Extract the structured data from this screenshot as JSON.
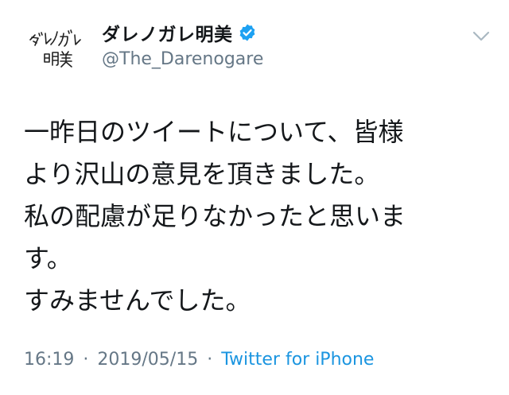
{
  "tweet": {
    "display_name": "ダレノガレ明美",
    "handle": "@The_Darenogare",
    "avatar_alt": "ダレノガレ明美",
    "text_lines": [
      "一昨日のツイートについて、皆様",
      "より沢山の意見を頂きました。",
      "私の配慮が足りなかったと思いま",
      "す。",
      "すみませんでした。"
    ],
    "time": "16:19",
    "date": "2019/05/15",
    "separator": "·",
    "source": "Twitter for iPhone"
  },
  "colors": {
    "text": "#14171a",
    "secondary": "#657786",
    "link": "#1b95e0",
    "verified": "#1da1f2"
  },
  "icons": {
    "verified": "verified-badge-icon",
    "menu": "chevron-down-icon"
  }
}
